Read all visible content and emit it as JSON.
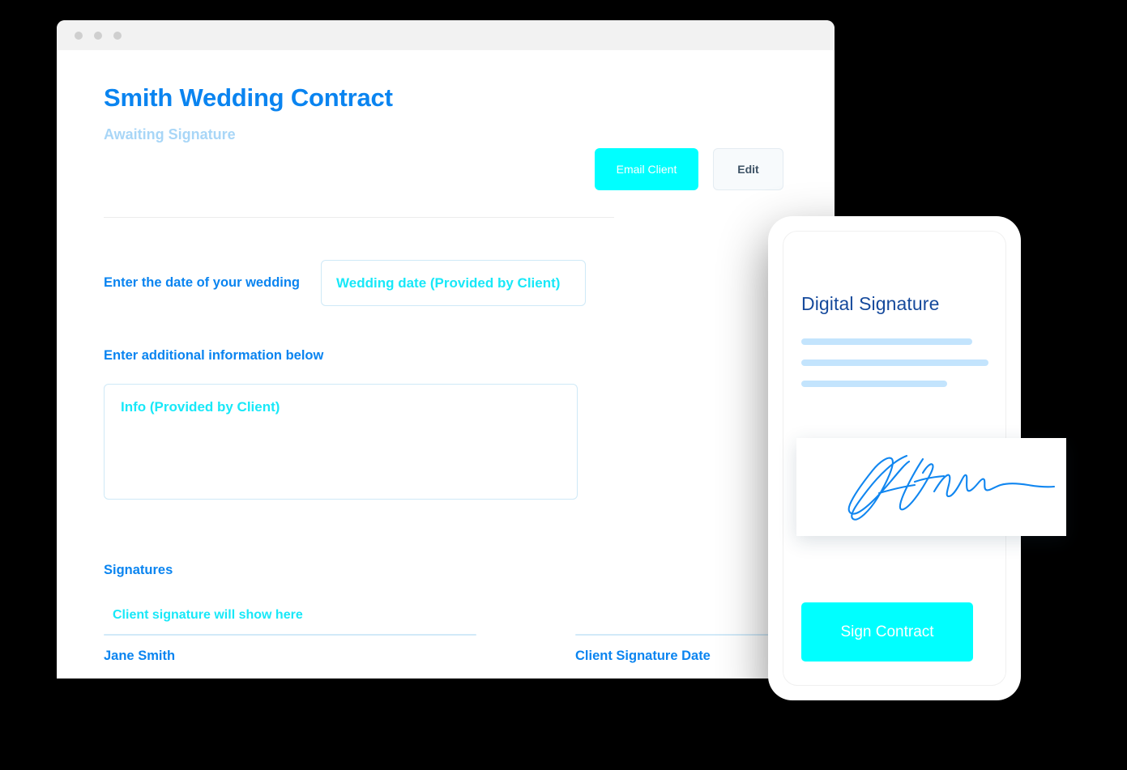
{
  "window": {
    "traffic_lights": [
      "close-dot",
      "minimize-dot",
      "maximize-dot"
    ]
  },
  "document": {
    "title": "Smith Wedding Contract",
    "status": "Awaiting Signature",
    "actions": {
      "email_client_label": "Email Client",
      "edit_label": "Edit"
    },
    "fields": [
      {
        "label": "Enter the date of your wedding",
        "input_placeholder": "Wedding date (Provided by Client)",
        "value": ""
      },
      {
        "label": "Enter additional information below",
        "input_placeholder": "Info (Provided by Client)",
        "value": ""
      }
    ],
    "signatures": {
      "heading": "Signatures",
      "client_signature_placeholder": "Client signature will show here",
      "left_name": "Jane Smith",
      "right_name": "Client Signature Date"
    }
  },
  "phone": {
    "title": "Digital Signature",
    "skeleton_bars": [
      211,
      231,
      180
    ],
    "signature_alt": "handwritten-signature",
    "sign_button_label": "Sign Contract"
  },
  "colors": {
    "brand_blue": "#0a84f0",
    "accent_cyan": "#00ffff",
    "placeholder_cyan": "#18e8f8",
    "muted_blue": "#a8d6f7",
    "navy": "#164a9c",
    "skeleton_blue": "#c3e4fd",
    "line_blue": "#d2eaf8",
    "background": "#000000"
  }
}
